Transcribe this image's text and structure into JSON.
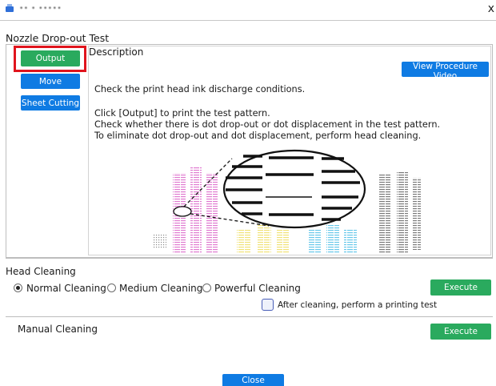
{
  "window": {
    "title": "•• •  •••••",
    "close_glyph": "x"
  },
  "nozzle_test": {
    "title": "Nozzle Drop-out Test",
    "buttons": {
      "output": "Output",
      "move": "Move",
      "sheet_cutting": "Sheet Cutting"
    },
    "description": {
      "heading": "Description",
      "video_button": "View Procedure Video",
      "line1": "Check the print head ink discharge conditions.",
      "line2": "Click [Output] to print the test pattern.",
      "line3": "Check whether there is dot drop-out or dot displacement in the test pattern.",
      "line4": "To eliminate dot drop-out and dot displacement, perform head cleaning."
    }
  },
  "head_cleaning": {
    "title": "Head Cleaning",
    "options": [
      "Normal Cleaning",
      "Medium Cleaning",
      "Powerful Cleaning"
    ],
    "selected_option": "Normal Cleaning",
    "execute_label": "Execute",
    "print_test_label": "After cleaning, perform a printing test",
    "print_test_checked": false
  },
  "manual_cleaning": {
    "title": "Manual Cleaning",
    "execute_label": "Execute"
  },
  "footer": {
    "close_label": "Close"
  },
  "colors": {
    "green_button": "#2aaa5e",
    "blue_button": "#0f7be3",
    "highlight_frame": "#e0141d",
    "ink_magenta": "#e07ad0",
    "ink_yellow": "#f1e277",
    "ink_cyan": "#67c8ea",
    "ink_black": "#6e6e6e"
  }
}
